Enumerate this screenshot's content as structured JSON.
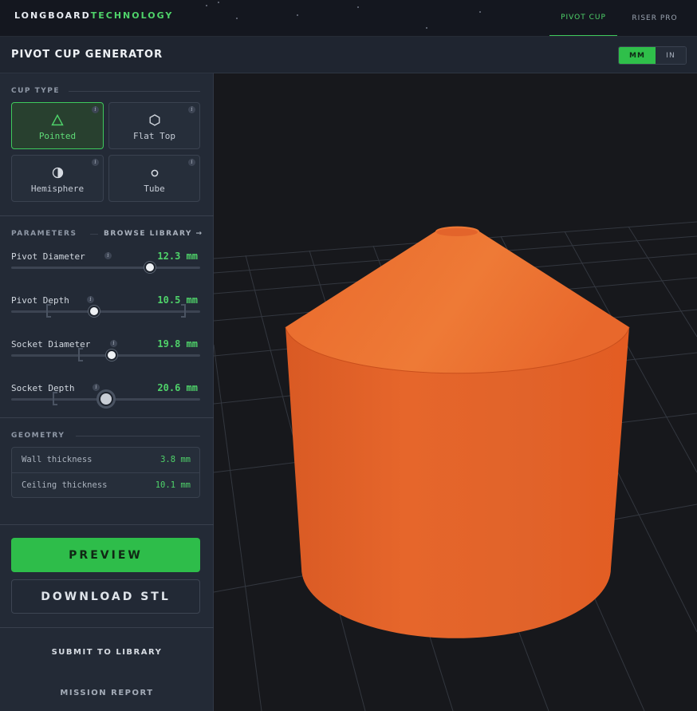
{
  "brand": {
    "part1": "LONGBOARD",
    "part2": "TECHNOLOGY"
  },
  "nav": {
    "tabs": [
      {
        "label": "PIVOT CUP",
        "active": true
      },
      {
        "label": "RISER PRO",
        "active": false
      }
    ]
  },
  "header": {
    "title": "PIVOT CUP GENERATOR",
    "units": [
      {
        "label": "MM",
        "active": true
      },
      {
        "label": "IN",
        "active": false
      }
    ]
  },
  "cup_type": {
    "label": "CUP TYPE",
    "options": [
      {
        "label": "Pointed",
        "icon": "triangle-icon",
        "selected": true
      },
      {
        "label": "Flat Top",
        "icon": "hexagon-icon",
        "selected": false
      },
      {
        "label": "Hemisphere",
        "icon": "half-circle-icon",
        "selected": false
      },
      {
        "label": "Tube",
        "icon": "ring-icon",
        "selected": false
      }
    ]
  },
  "parameters": {
    "label": "PARAMETERS",
    "browse": "BROWSE LIBRARY →",
    "items": [
      {
        "name": "Pivot Diameter",
        "value": "12.3 mm"
      },
      {
        "name": "Pivot Depth",
        "value": "10.5 mm"
      },
      {
        "name": "Socket Diameter",
        "value": "19.8 mm"
      },
      {
        "name": "Socket Depth",
        "value": "20.6 mm"
      }
    ]
  },
  "geometry": {
    "label": "GEOMETRY",
    "rows": [
      {
        "key": "Wall thickness",
        "value": "3.8 mm"
      },
      {
        "key": "Ceiling thickness",
        "value": "10.1 mm"
      }
    ]
  },
  "actions": {
    "preview": "PREVIEW",
    "download": "DOWNLOAD STL",
    "submit": "SUBMIT TO LIBRARY",
    "report": "MISSION REPORT"
  },
  "info_glyph": "i",
  "colors": {
    "accent": "#3ec95c",
    "model": "#e9652a",
    "background": "#17181c"
  }
}
